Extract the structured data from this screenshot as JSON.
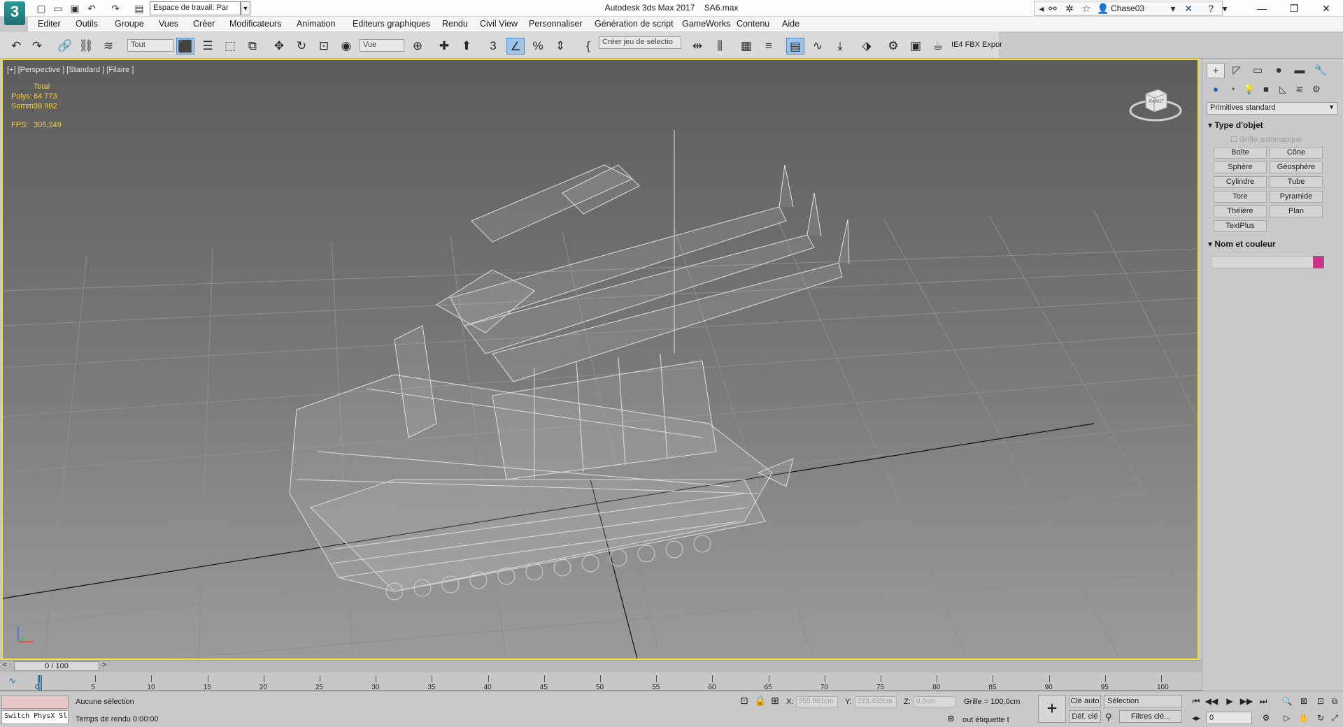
{
  "titlebar": {
    "logo": "3",
    "workspace": "Espace de travail: Par",
    "title": "Autodesk 3ds Max 2017",
    "file": "SA6.max",
    "user": "Chase03"
  },
  "menu": [
    "Editer",
    "Outils",
    "Groupe",
    "Vues",
    "Créer",
    "Modificateurs",
    "Animation",
    "Editeurs graphiques",
    "Rendu",
    "Civil View",
    "Personnaliser",
    "Génération de script",
    "GameWorks",
    "Contenu",
    "Aide"
  ],
  "toolbar": {
    "filter": "Tout",
    "refcoord": "Vue",
    "selection_set": "Créer jeu de sélectio",
    "fbx_label": "IE4 FBX Expor"
  },
  "viewport": {
    "label": "[+] [Perspective ] [Standard ] [Filaire ]",
    "stats_total": "Total",
    "polys_label": "Polys:",
    "polys_value": "64 773",
    "verts_label": "Somm:",
    "verts_value": "38 982",
    "fps_label": "FPS:",
    "fps_value": "305,249",
    "viewcube_label": "AVANT"
  },
  "command_panel": {
    "primitives": "Primitives standard",
    "object_type_title": "Type d'objet",
    "auto_grid": "Grille automatique",
    "buttons": [
      "Boîte",
      "Cône",
      "Sphère",
      "Géosphère",
      "Cylindre",
      "Tube",
      "Tore",
      "Pyramide",
      "Théière",
      "Plan",
      "TextPlus"
    ],
    "name_color_title": "Nom et couleur",
    "object_color": "#d22e8a"
  },
  "timeline": {
    "slider_label": "0 / 100",
    "ticks": [
      "0",
      "5",
      "10",
      "15",
      "20",
      "25",
      "30",
      "35",
      "40",
      "45",
      "50",
      "55",
      "60",
      "65",
      "70",
      "75",
      "80",
      "85",
      "90",
      "95",
      "100"
    ]
  },
  "status": {
    "script_listener": "Switch PhysX Sl",
    "selection": "Aucune sélection",
    "render_time": "Temps de rendu 0:00:00",
    "x_label": "X:",
    "x_value": "555,861cm",
    "y_label": "Y:",
    "y_value": "223,432cm",
    "z_label": "Z:",
    "z_value": "0,0cm",
    "grid": "Grille = 100,0cm",
    "tag": "out étiquette t",
    "auto_key": "Clé auto",
    "set_key": "Déf. clé",
    "selection_dropdown": "Sélection",
    "key_filters": "Filtres clé...",
    "frame": "0"
  },
  "accent": "#f0e03c"
}
